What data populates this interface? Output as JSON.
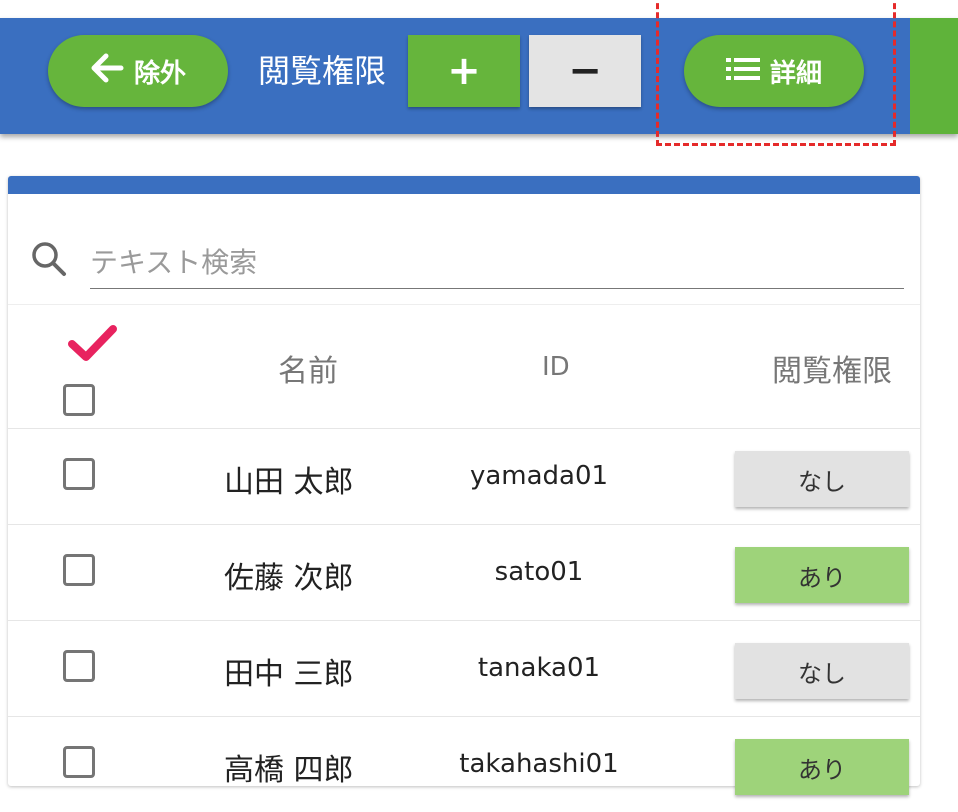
{
  "toolbar": {
    "exclude_label": "除外",
    "permission_label": "閲覧権限",
    "plus_label": "+",
    "minus_label": "−",
    "detail_label": "詳細"
  },
  "search": {
    "placeholder": "テキスト検索",
    "value": ""
  },
  "table": {
    "headers": {
      "name": "名前",
      "id": "ID",
      "permission": "閲覧権限"
    },
    "rows": [
      {
        "name": "山田 太郎",
        "id": "yamada01",
        "permission": "なし",
        "has_permission": false
      },
      {
        "name": "佐藤 次郎",
        "id": "sato01",
        "permission": "あり",
        "has_permission": true
      },
      {
        "name": "田中 三郎",
        "id": "tanaka01",
        "permission": "なし",
        "has_permission": false
      },
      {
        "name": "高橋 四郎",
        "id": "takahashi01",
        "permission": "あり",
        "has_permission": true
      }
    ]
  },
  "colors": {
    "toolbar_blue": "#3a6fc0",
    "accent_green": "#66b53c",
    "permission_yes": "#9ed37a",
    "permission_no": "#e2e2e2",
    "check_pink": "#e8235f",
    "highlight_dash": "#e52a2a"
  },
  "icons": {
    "back": "arrow-left-icon",
    "detail": "list-icon",
    "search": "search-icon",
    "check": "checkmark-icon"
  }
}
